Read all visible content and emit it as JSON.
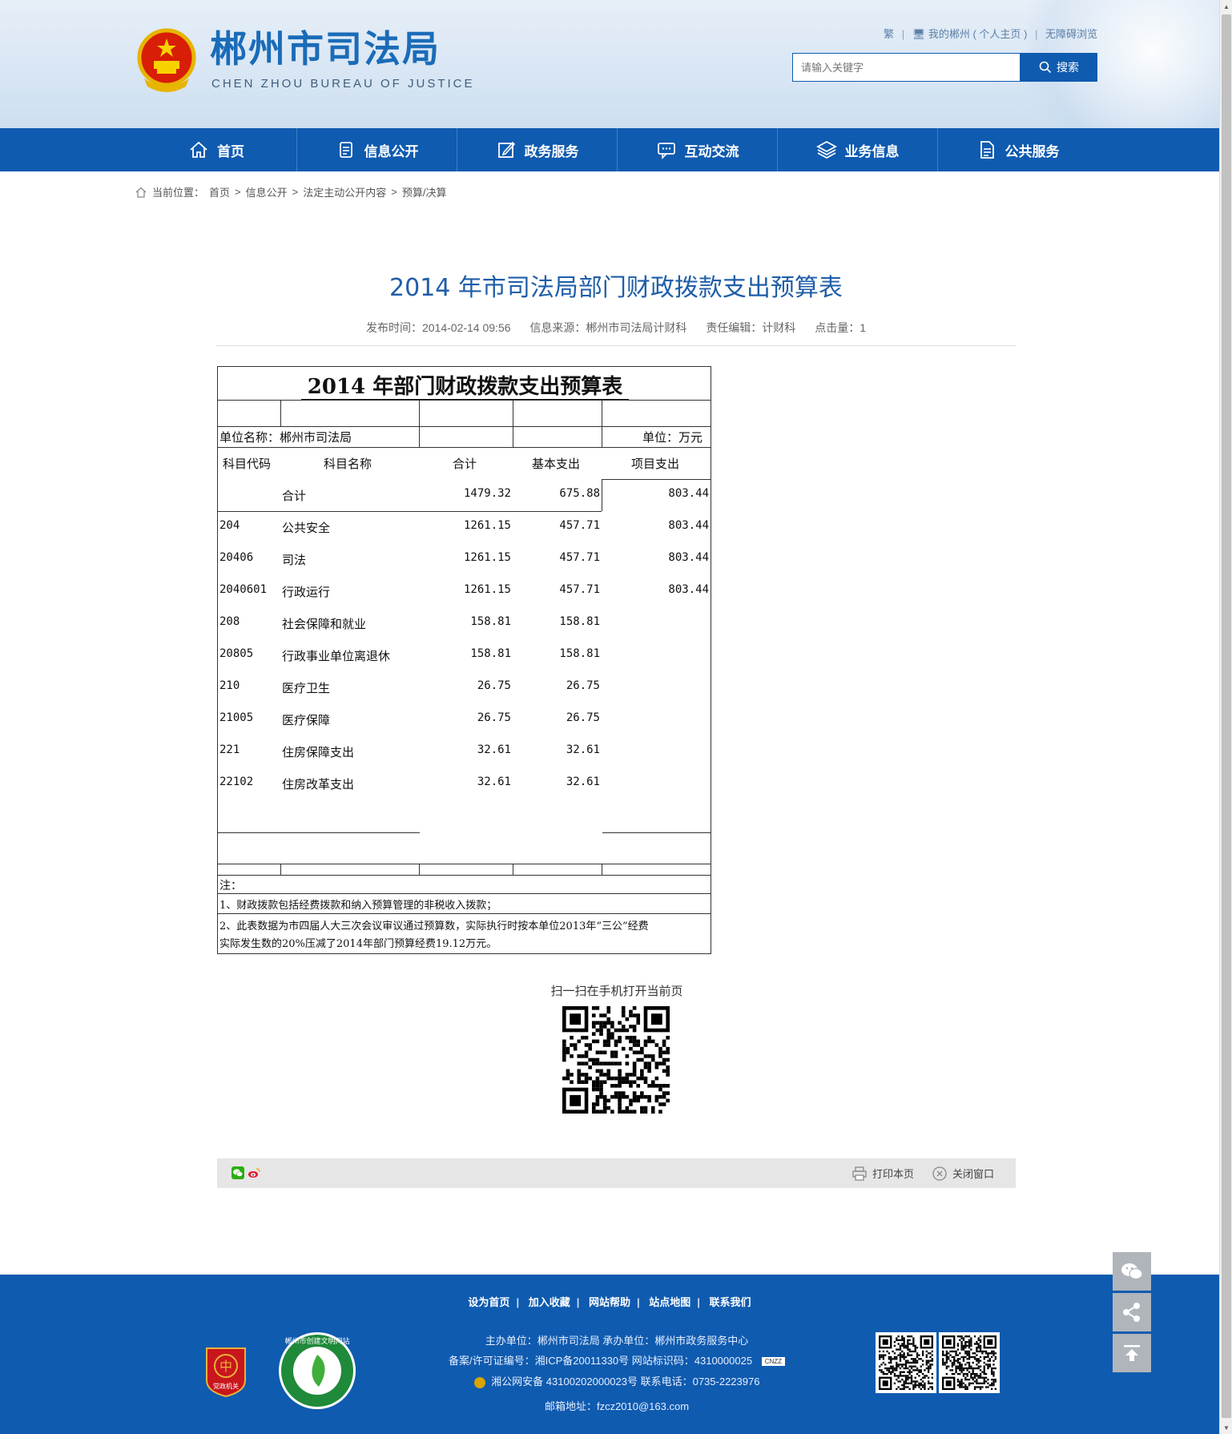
{
  "header": {
    "site_title": "郴州市司法局",
    "site_subtitle": "CHEN ZHOU BUREAU OF JUSTICE",
    "top_links": {
      "simplified": "繁",
      "my_chenzhou": "我的郴州 ( 个人主页 )",
      "accessible": "无障碍浏览"
    },
    "search": {
      "placeholder": "请输入关键字",
      "button": "搜索"
    }
  },
  "nav": [
    {
      "label": "首页",
      "icon": "home-icon"
    },
    {
      "label": "信息公开",
      "icon": "document-icon"
    },
    {
      "label": "政务服务",
      "icon": "edit-icon"
    },
    {
      "label": "互动交流",
      "icon": "chat-icon"
    },
    {
      "label": "业务信息",
      "icon": "layers-icon"
    },
    {
      "label": "公共服务",
      "icon": "file-icon"
    }
  ],
  "breadcrumb": {
    "prefix": "当前位置：",
    "items": [
      "首页",
      "信息公开",
      "法定主动公开内容",
      "预算/决算"
    ],
    "separator": ">"
  },
  "article": {
    "title": "2014 年市司法局部门财政拨款支出预算表",
    "publish_time": "发布时间：2014-02-14 09:56",
    "source": "信息来源：郴州市司法局计财科",
    "editor": "责任编辑：计财科",
    "hits": "点击量：1"
  },
  "budget_table": {
    "title": "2014 年部门财政拨款支出预算表",
    "unit_name": "单位名称：郴州市司法局",
    "unit": "单位：万元",
    "headers": [
      "科目代码",
      "科目名称",
      "合计",
      "基本支出",
      "项目支出"
    ],
    "rows": [
      {
        "code": "",
        "name": "合计",
        "total": "1479.32",
        "basic": "675.88",
        "project": "803.44"
      },
      {
        "code": "204",
        "name": "公共安全",
        "total": "1261.15",
        "basic": "457.71",
        "project": "803.44"
      },
      {
        "code": "20406",
        "name": "司法",
        "total": "1261.15",
        "basic": "457.71",
        "project": "803.44"
      },
      {
        "code": "2040601",
        "name": "行政运行",
        "total": "1261.15",
        "basic": "457.71",
        "project": "803.44"
      },
      {
        "code": "208",
        "name": "社会保障和就业",
        "total": "158.81",
        "basic": "158.81",
        "project": ""
      },
      {
        "code": "20805",
        "name": "行政事业单位离退休",
        "total": "158.81",
        "basic": "158.81",
        "project": ""
      },
      {
        "code": "210",
        "name": "医疗卫生",
        "total": "26.75",
        "basic": "26.75",
        "project": ""
      },
      {
        "code": "21005",
        "name": "医疗保障",
        "total": "26.75",
        "basic": "26.75",
        "project": ""
      },
      {
        "code": "221",
        "name": "住房保障支出",
        "total": "32.61",
        "basic": "32.61",
        "project": ""
      },
      {
        "code": "22102",
        "name": "住房改革支出",
        "total": "32.61",
        "basic": "32.61",
        "project": ""
      }
    ],
    "note_label": "注：",
    "note_1": "1、财政拨款包括经费拨款和纳入预算管理的非税收入拨款；",
    "note_2a": "2、此表数据为市四届人大三次会议审议通过预算数，实际执行时按本单位2013年“三公”经费",
    "note_2b": "实际发生数的20%压减了2014年部门预算经费19.12万元。"
  },
  "qr": {
    "label": "扫一扫在手机打开当前页"
  },
  "sharebar": {
    "print": "打印本页",
    "close": "关闭窗口"
  },
  "footer": {
    "links": [
      "设为首页",
      "加入收藏",
      "网站帮助",
      "站点地图",
      "联系我们"
    ],
    "host": "主办单位：郴州市司法局   承办单位：郴州市政务服务中心",
    "icp": "备案/许可证编号：湘ICP备20011330号   网站标识码：4310000025",
    "police": "湘公网安备 43100202000023号   联系电话：0735-2223976",
    "email": "邮箱地址：fzcz2010@163.com",
    "badge_text": "党政机关",
    "badge2_text": "郴州市创建文明网站",
    "cnzz": "CNZZ"
  },
  "colors": {
    "brand_blue": "#0f5bb0",
    "title_blue": "#1f5ea8"
  }
}
